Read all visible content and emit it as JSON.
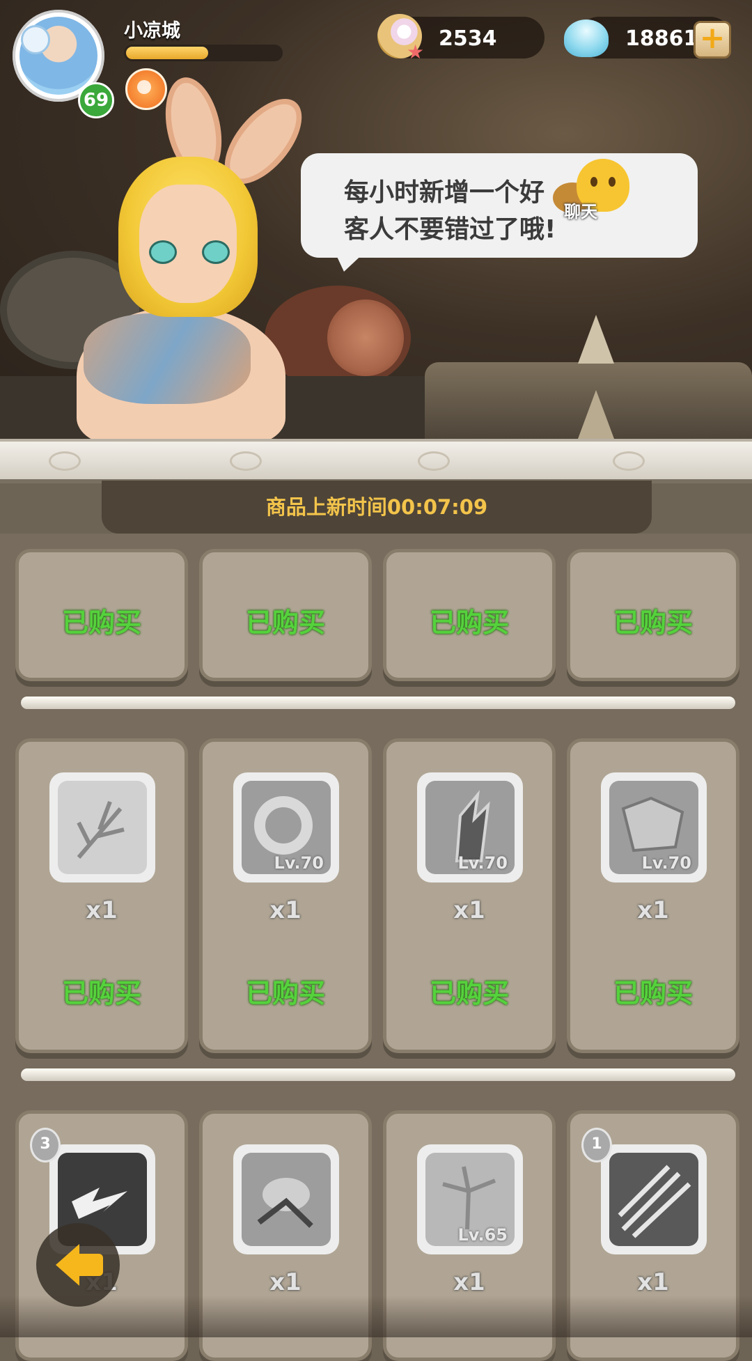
{
  "player": {
    "name": "小凉城",
    "level": "69",
    "exp_fraction": 0.53
  },
  "currency": {
    "pearls": "2534",
    "shells": "18861"
  },
  "npc": {
    "speech_line1": "每小时新增一个好",
    "speech_line2": "客人不要错过了哦!",
    "chat_label": "聊天"
  },
  "shop": {
    "refresh_label": "商品上新时间00:07:09",
    "row1": [
      {
        "status": "已购买"
      },
      {
        "status": "已购买"
      },
      {
        "status": "已购买"
      },
      {
        "status": "已购买"
      }
    ],
    "row2": [
      {
        "icon": "herb-branch-icon",
        "level": "",
        "qty": "x1",
        "status": "已购买"
      },
      {
        "icon": "stone-ring-icon",
        "level": "Lv.70",
        "qty": "x1",
        "status": "已购买"
      },
      {
        "icon": "spiked-boot-icon",
        "level": "Lv.70",
        "qty": "x1",
        "status": "已购买"
      },
      {
        "icon": "stone-armor-icon",
        "level": "Lv.70",
        "qty": "x1",
        "status": "已购买"
      }
    ],
    "row3": [
      {
        "icon": "lightning-skill-icon",
        "level": "",
        "badge": "3",
        "qty": "x1"
      },
      {
        "icon": "leaf-herb-icon",
        "level": "",
        "badge": "",
        "qty": "x1"
      },
      {
        "icon": "palm-plant-icon",
        "level": "Lv.65",
        "badge": "",
        "qty": "x1"
      },
      {
        "icon": "claw-slash-icon",
        "level": "",
        "badge": "1",
        "qty": "x1"
      }
    ]
  },
  "colors": {
    "bought_text": "#55d23c",
    "timer_text": "#f3c44b",
    "level_badge": "#3aa83a"
  }
}
